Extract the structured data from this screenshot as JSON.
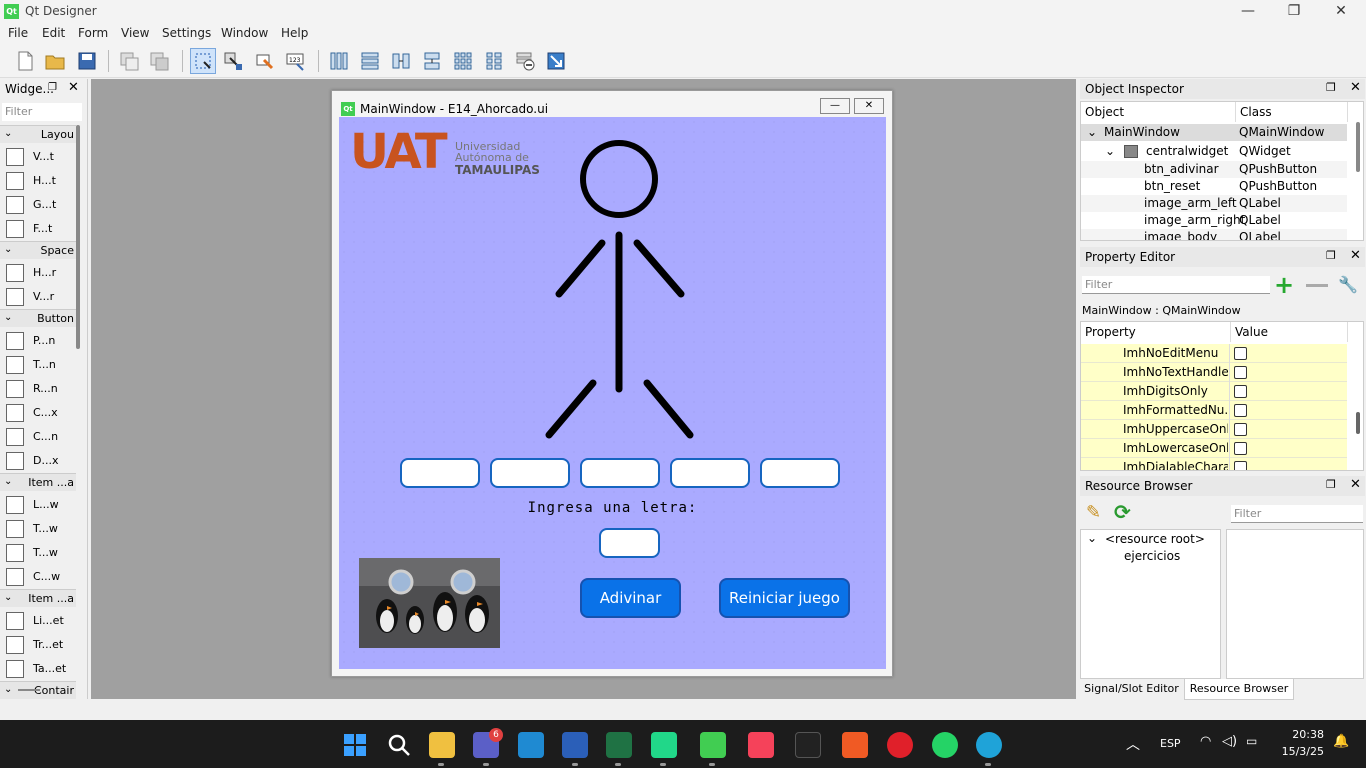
{
  "app": {
    "title": "Qt Designer",
    "logo": "Qt"
  },
  "window_controls": {
    "minimize": "—",
    "maximize": "❐",
    "close": "✕"
  },
  "menu": [
    "File",
    "Edit",
    "Form",
    "View",
    "Settings",
    "Window",
    "Help"
  ],
  "toolbar_icons": [
    "new-file-icon",
    "open-folder-icon",
    "save-icon",
    "copy-icon",
    "paste-icon",
    "edit-widgets-icon",
    "edit-signals-icon",
    "edit-buddies-icon",
    "edit-tab-order-icon",
    "layout-horizontal-icon",
    "layout-vertical-icon",
    "layout-splitter-h-icon",
    "layout-splitter-v-icon",
    "layout-grid-icon",
    "layout-form-icon",
    "break-layout-icon",
    "adjust-size-icon"
  ],
  "widget_box": {
    "title": "Widge...",
    "filter_placeholder": "Filter",
    "categories": [
      {
        "label": "Layou",
        "items": [
          "V...t",
          "H...t",
          "G...t",
          "F...t"
        ]
      },
      {
        "label": "Space",
        "items": [
          "H...r",
          "V...r"
        ]
      },
      {
        "label": "Button",
        "items": [
          "P...n",
          "T...n",
          "R...n",
          "C...x",
          "C...n",
          "D...x"
        ]
      },
      {
        "label": "Item ...a",
        "items": [
          "L...w",
          "T...w",
          "T...w",
          "C...w"
        ]
      },
      {
        "label": "Item ...a",
        "items": [
          "Li...et",
          "Tr...et",
          "Ta...et"
        ]
      },
      {
        "label": "Contair",
        "items": []
      }
    ]
  },
  "form": {
    "title": "MainWindow - E14_Ahorcado.ui",
    "logo": {
      "big": "UAT",
      "line1": "Universidad",
      "line2": "Autónoma de",
      "line3": "TAMAULIPAS"
    },
    "prompt": "Ingresa una letra:",
    "btn_guess": "Adivinar",
    "btn_reset": "Reiniciar juego",
    "slots": 5,
    "canvas_color": "#aaaaff",
    "button_color": "#0a72e8"
  },
  "object_inspector": {
    "title": "Object Inspector",
    "col_object": "Object",
    "col_class": "Class",
    "rows": [
      {
        "object": "MainWindow",
        "class": "QMainWindow"
      },
      {
        "object": "centralwidget",
        "class": "QWidget"
      },
      {
        "object": "btn_adivinar",
        "class": "QPushButton"
      },
      {
        "object": "btn_reset",
        "class": "QPushButton"
      },
      {
        "object": "image_arm_left",
        "class": "QLabel"
      },
      {
        "object": "image_arm_right",
        "class": "QLabel"
      },
      {
        "object": "image_body",
        "class": "QLabel"
      }
    ]
  },
  "property_editor": {
    "title": "Property Editor",
    "filter_placeholder": "Filter",
    "context": "MainWindow : QMainWindow",
    "col_property": "Property",
    "col_value": "Value",
    "rows": [
      "ImhNoEditMenu",
      "ImhNoTextHandles",
      "ImhDigitsOnly",
      "ImhFormattedNu...",
      "ImhUppercaseOnly",
      "ImhLowercaseOnly",
      "ImhDialableChara..."
    ]
  },
  "resource_browser": {
    "title": "Resource Browser",
    "filter_placeholder": "Filter",
    "tree_root": "<resource root>",
    "tree_child": "ejercicios"
  },
  "bottom_tabs": [
    "Signal/Slot Editor",
    "Resource Browser"
  ],
  "taskbar": {
    "time": "20:38",
    "date": "15/3/25",
    "lang": "ESP",
    "teams_badge": "6",
    "apps": [
      "windows-start-icon",
      "search-icon",
      "file-explorer-icon",
      "teams-icon",
      "vscode-icon",
      "word-icon",
      "excel-icon",
      "pycharm-icon",
      "qt-designer-icon",
      "itunes-icon",
      "apple-tv-icon",
      "brave-icon",
      "opera-icon",
      "whatsapp-icon",
      "edge-icon"
    ]
  }
}
